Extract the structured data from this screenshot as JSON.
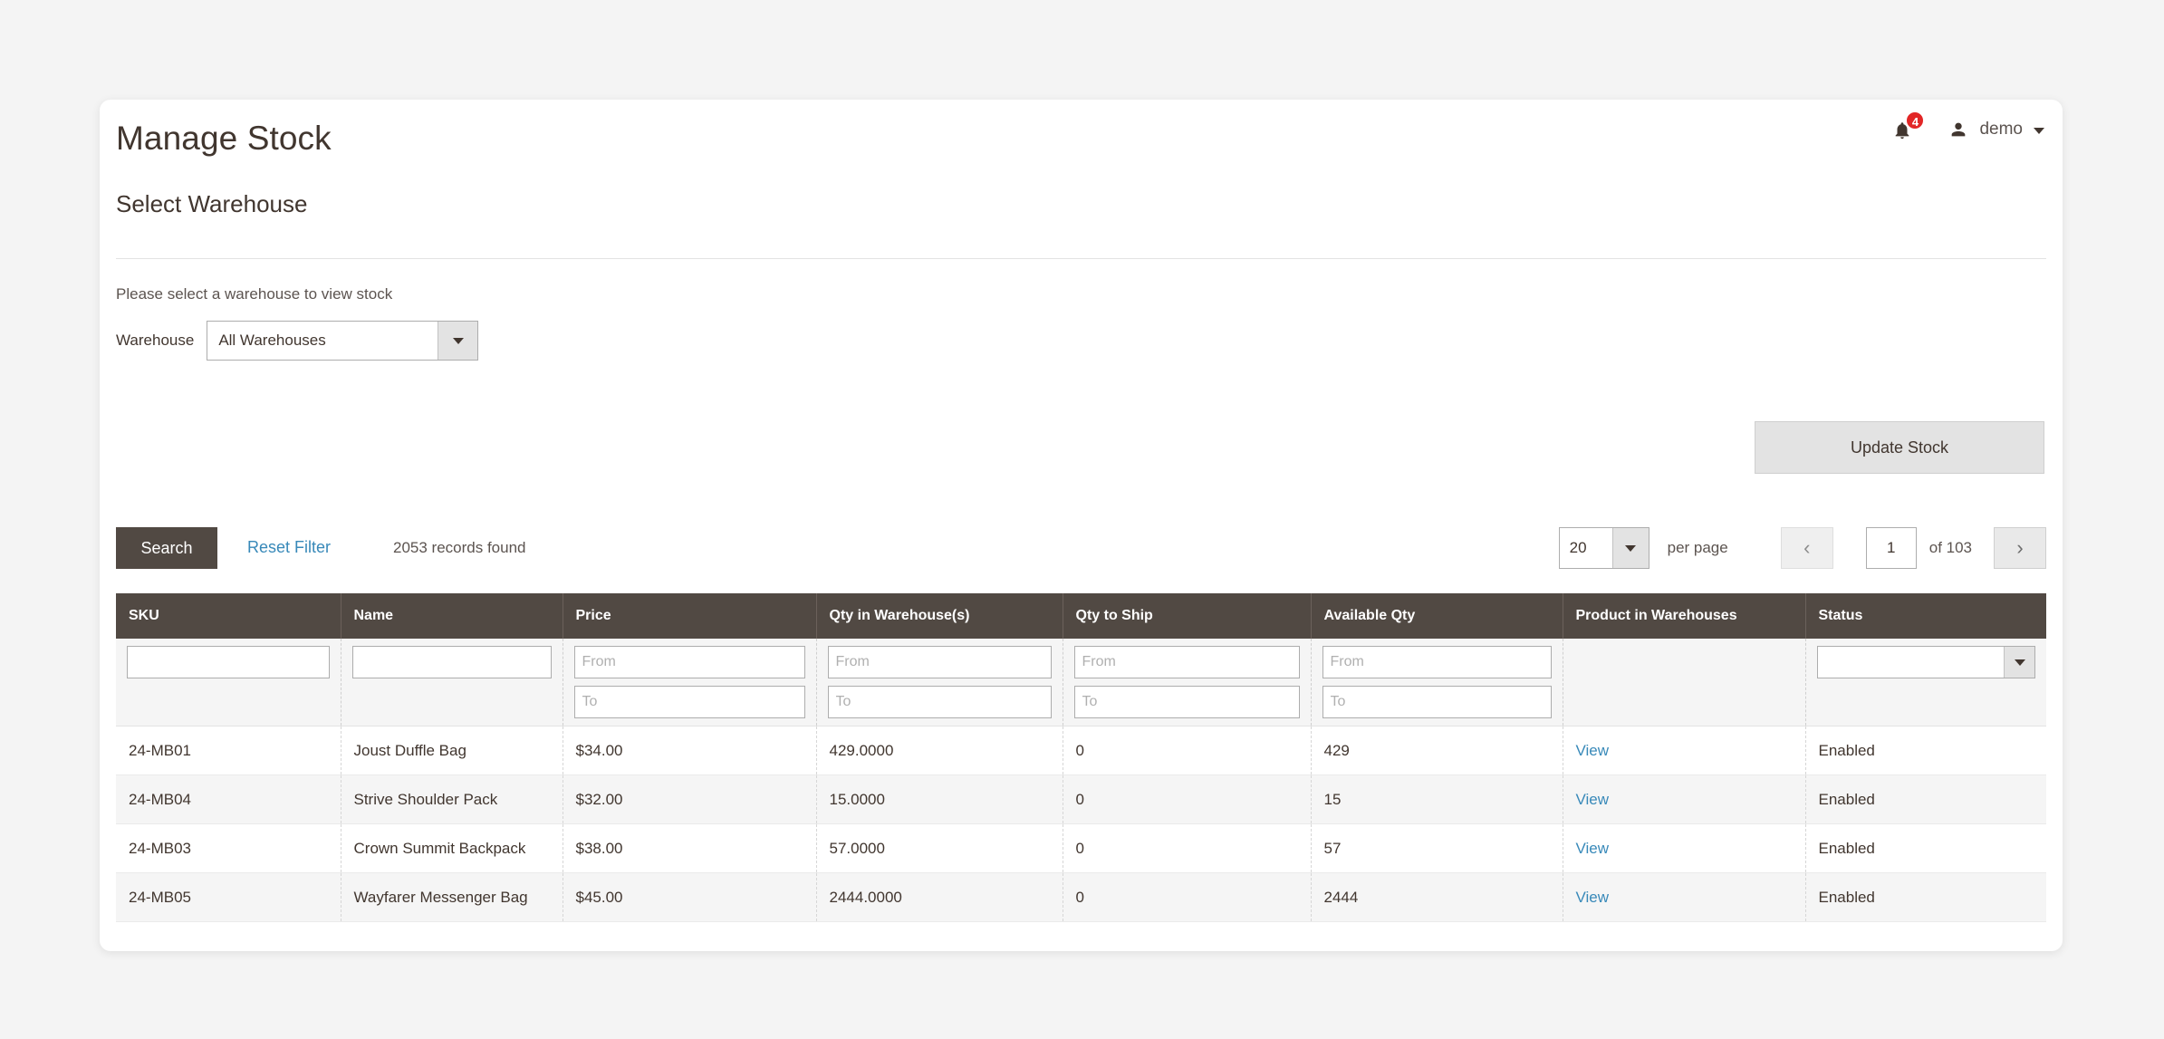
{
  "header": {
    "title": "Manage Stock",
    "notification_count": "4",
    "user_name": "demo"
  },
  "section": {
    "title": "Select Warehouse",
    "hint": "Please select a warehouse to view stock",
    "warehouse_label": "Warehouse",
    "warehouse_value": "All Warehouses"
  },
  "actions": {
    "update_stock": "Update Stock",
    "search": "Search",
    "reset_filter": "Reset Filter",
    "records_found": "2053 records found"
  },
  "pagination": {
    "per_page_value": "20",
    "per_page_label": "per page",
    "current_page": "1",
    "of_label": "of 103"
  },
  "table": {
    "columns": [
      "SKU",
      "Name",
      "Price",
      "Qty in Warehouse(s)",
      "Qty to Ship",
      "Available Qty",
      "Product in Warehouses",
      "Status"
    ],
    "filters": {
      "sku": "",
      "name": "",
      "price_from": "From",
      "price_to": "To",
      "qty_warehouse_from": "From",
      "qty_warehouse_to": "To",
      "qty_ship_from": "From",
      "qty_ship_to": "To",
      "available_from": "From",
      "available_to": "To",
      "status": ""
    },
    "rows": [
      {
        "sku": "24-MB01",
        "name": "Joust Duffle Bag",
        "price": "$34.00",
        "qty_warehouse": "429.0000",
        "qty_ship": "0",
        "available": "429",
        "product_in_warehouses": "View",
        "status": "Enabled"
      },
      {
        "sku": "24-MB04",
        "name": "Strive Shoulder Pack",
        "price": "$32.00",
        "qty_warehouse": "15.0000",
        "qty_ship": "0",
        "available": "15",
        "product_in_warehouses": "View",
        "status": "Enabled"
      },
      {
        "sku": "24-MB03",
        "name": "Crown Summit Backpack",
        "price": "$38.00",
        "qty_warehouse": "57.0000",
        "qty_ship": "0",
        "available": "57",
        "product_in_warehouses": "View",
        "status": "Enabled"
      },
      {
        "sku": "24-MB05",
        "name": "Wayfarer Messenger Bag",
        "price": "$45.00",
        "qty_warehouse": "2444.0000",
        "qty_ship": "0",
        "available": "2444",
        "product_in_warehouses": "View",
        "status": "Enabled"
      }
    ]
  },
  "colors": {
    "header_dark": "#514943",
    "link_blue": "#3889b9",
    "badge_red": "#e22626"
  }
}
